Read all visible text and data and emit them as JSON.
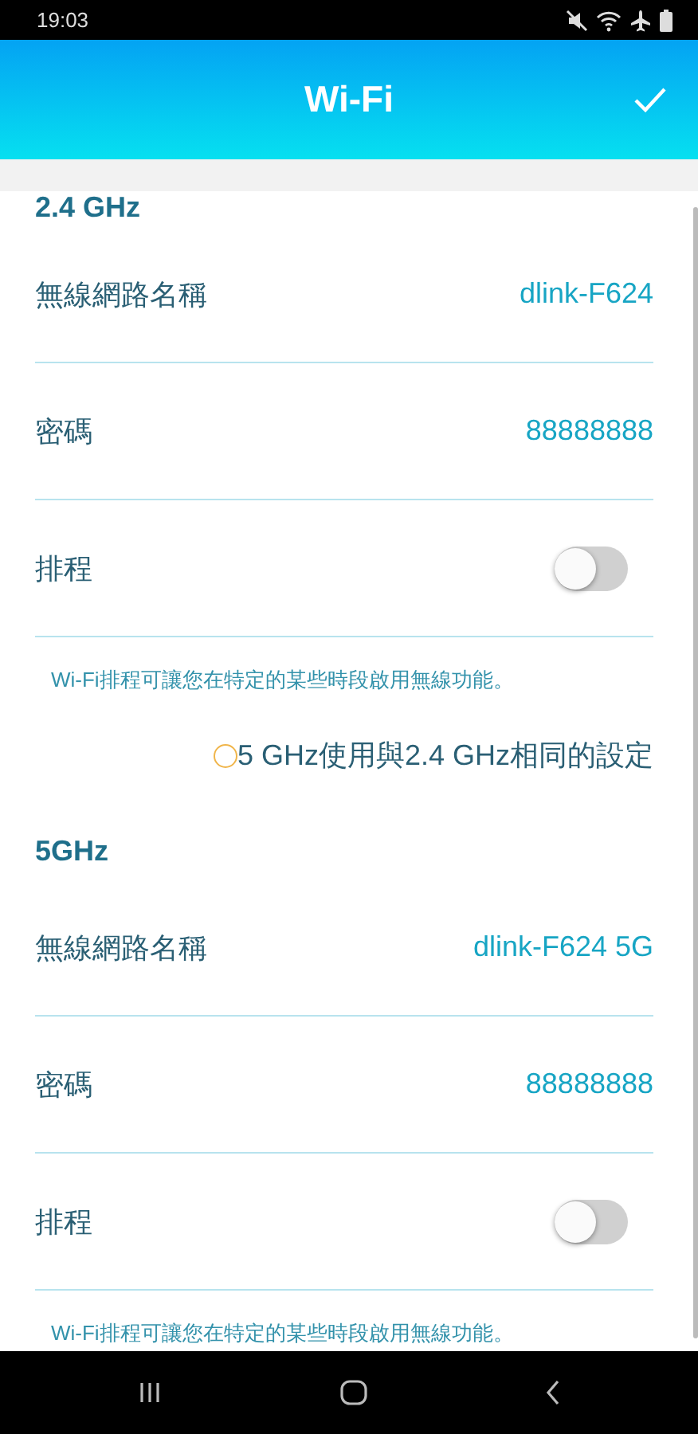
{
  "status_bar": {
    "time": "19:03"
  },
  "header": {
    "title": "Wi-Fi"
  },
  "sections": [
    {
      "heading": "2.4 GHz",
      "rows": [
        {
          "kind": "text",
          "label": "無線網路名稱",
          "value": "dlink-F624"
        },
        {
          "kind": "text",
          "label": "密碼",
          "value": "88888888"
        },
        {
          "kind": "toggle",
          "label": "排程",
          "on": false
        }
      ],
      "description": "Wi-Fi排程可讓您在特定的某些時段啟用無線功能。",
      "option": {
        "label": "5 GHz使用與2.4 GHz相同的設定",
        "checked": false
      }
    },
    {
      "heading": "5GHz",
      "rows": [
        {
          "kind": "text",
          "label": "無線網路名稱",
          "value": "dlink-F624 5G"
        },
        {
          "kind": "text",
          "label": "密碼",
          "value": "88888888"
        },
        {
          "kind": "toggle",
          "label": "排程",
          "on": false
        }
      ],
      "description": "Wi-Fi排程可讓您在特定的某些時段啟用無線功能。"
    }
  ]
}
